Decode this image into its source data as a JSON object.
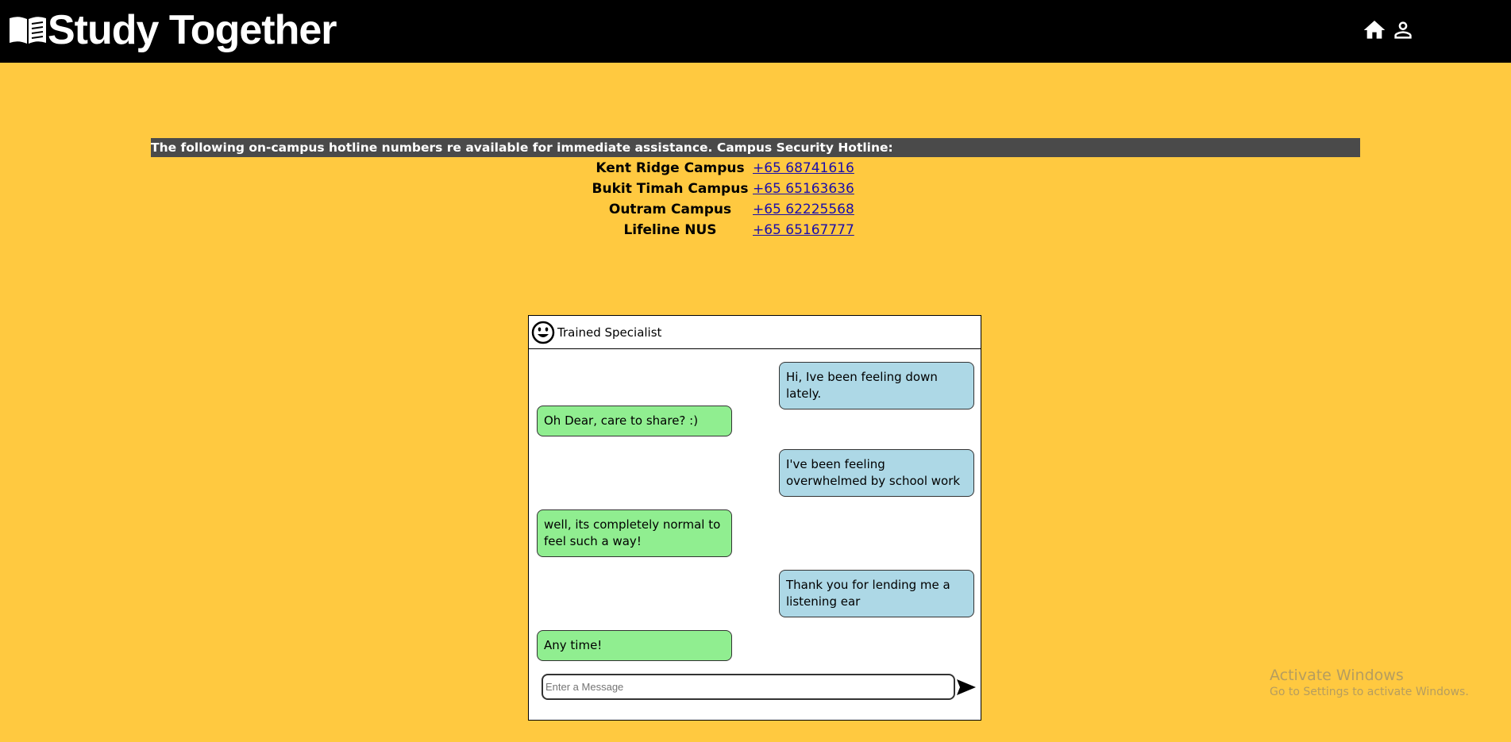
{
  "header": {
    "brand_title": "Study Together",
    "icons": [
      "book-icon",
      "home-icon",
      "user-icon"
    ]
  },
  "notice": {
    "text": "The following on-campus hotline numbers re available for immediate assistance. Campus Security Hotline:"
  },
  "hotlines": [
    {
      "name": "Kent Ridge Campus",
      "phone": "+65 68741616"
    },
    {
      "name": "Bukit Timah Campus",
      "phone": "+65 65163636"
    },
    {
      "name": "Outram Campus",
      "phone": "+65 62225568"
    },
    {
      "name": "Lifeline NUS",
      "phone": "+65 65167777"
    }
  ],
  "chat": {
    "header_title": "Trained Specialist",
    "messages": [
      {
        "from": "user",
        "text": "Hi, Ive been feeling down lately."
      },
      {
        "from": "specialist",
        "text": "Oh Dear, care to share? :)"
      },
      {
        "from": "user",
        "text": "I've been feeling overwhelmed by school work"
      },
      {
        "from": "specialist",
        "text": "well, its completely normal to feel such a way!"
      },
      {
        "from": "user",
        "text": "Thank you for lending me a listening ear"
      },
      {
        "from": "specialist",
        "text": "Any time!"
      }
    ],
    "input_placeholder": "Enter a Message",
    "input_value": ""
  },
  "watermark": {
    "line1": "Activate Windows",
    "line2": "Go to Settings to activate Windows."
  },
  "colors": {
    "background": "#ffc940",
    "navbar": "#000000",
    "notice_bg": "#4a4a4a",
    "user_bubble": "#add8e6",
    "specialist_bubble": "#90ee90",
    "link": "#1a0dab"
  }
}
